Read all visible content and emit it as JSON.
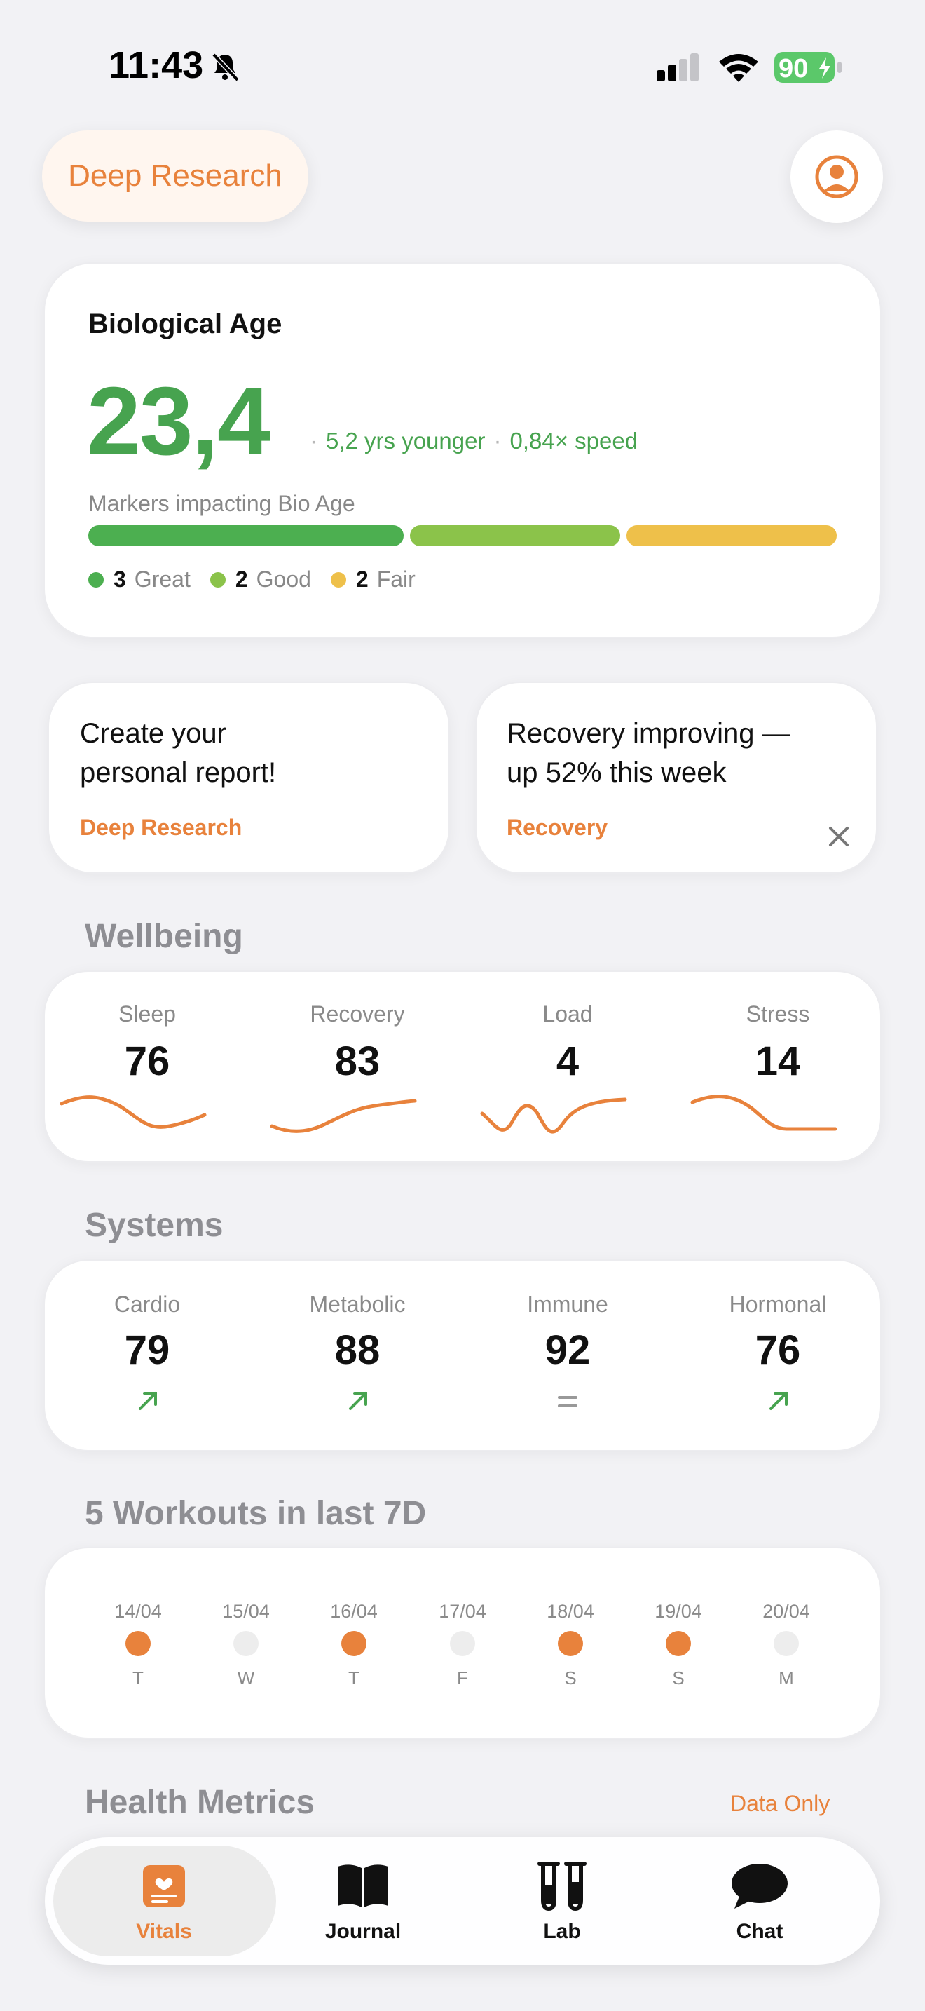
{
  "status_bar": {
    "time": "11:43",
    "battery": "90"
  },
  "header": {
    "deep_research_label": "Deep Research"
  },
  "bio_age": {
    "title": "Biological Age",
    "value": "23,4",
    "younger": "5,2 yrs younger",
    "speed": "0,84× speed",
    "markers_label": "Markers impacting Bio Age",
    "great_count": "3",
    "great_label": "Great",
    "good_count": "2",
    "good_label": "Good",
    "fair_count": "2",
    "fair_label": "Fair",
    "colors": {
      "great": "#4caf50",
      "good": "#8bc34a",
      "fair": "#eec04a"
    }
  },
  "promos": [
    {
      "text_line1": "Create your",
      "text_line2": "personal report!",
      "link": "Deep Research"
    },
    {
      "text_line1": "Recovery improving —",
      "text_line2": "up 52% this week",
      "link": "Recovery"
    }
  ],
  "wellbeing": {
    "title": "Wellbeing",
    "items": [
      {
        "label": "Sleep",
        "value": "76"
      },
      {
        "label": "Recovery",
        "value": "83"
      },
      {
        "label": "Load",
        "value": "4"
      },
      {
        "label": "Stress",
        "value": "14"
      }
    ]
  },
  "systems": {
    "title": "Systems",
    "items": [
      {
        "label": "Cardio",
        "value": "79",
        "trend": "up"
      },
      {
        "label": "Metabolic",
        "value": "88",
        "trend": "up"
      },
      {
        "label": "Immune",
        "value": "92",
        "trend": "equal"
      },
      {
        "label": "Hormonal",
        "value": "76",
        "trend": "up"
      }
    ]
  },
  "workouts": {
    "title": "5 Workouts in last 7D",
    "days": [
      {
        "date": "14/04",
        "day": "T",
        "done": true
      },
      {
        "date": "15/04",
        "day": "W",
        "done": false
      },
      {
        "date": "16/04",
        "day": "T",
        "done": true
      },
      {
        "date": "17/04",
        "day": "F",
        "done": false
      },
      {
        "date": "18/04",
        "day": "S",
        "done": true
      },
      {
        "date": "19/04",
        "day": "S",
        "done": true
      },
      {
        "date": "20/04",
        "day": "M",
        "done": false
      }
    ]
  },
  "health_metrics": {
    "title": "Health Metrics",
    "data_only": "Data Only"
  },
  "tabs": [
    {
      "label": "Vitals",
      "icon": "vitals-icon",
      "active": true
    },
    {
      "label": "Journal",
      "icon": "book-icon",
      "active": false
    },
    {
      "label": "Lab",
      "icon": "test-tubes-icon",
      "active": false
    },
    {
      "label": "Chat",
      "icon": "chat-bubble-icon",
      "active": false
    }
  ]
}
